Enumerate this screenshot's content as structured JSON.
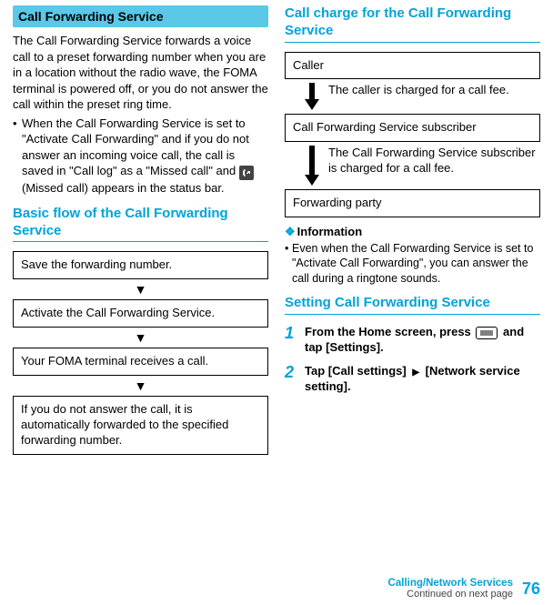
{
  "left": {
    "banner": "Call Forwarding Service",
    "intro": "The Call Forwarding Service forwards a voice call to a preset forwarding number when you are in a location without the radio wave, the FOMA terminal is powered off, or you do not answer the call within the preset ring time.",
    "bullet_pre": "When the Call Forwarding Service is set to \"Activate Call Forwarding\" and if you do not answer an incoming voice call, the call is saved in \"Call log\" as a \"Missed call\" and ",
    "bullet_post": " (Missed call) appears in the status bar.",
    "section_head": "Basic flow of the Call Forwarding Service",
    "flow": [
      "Save the forwarding number.",
      "Activate the Call Forwarding Service.",
      "Your FOMA terminal receives a call.",
      "If you do not answer the call, it is automatically forwarded to the specified forwarding number."
    ]
  },
  "right": {
    "section_head1": "Call charge for the Call Forwarding Service",
    "charge": {
      "box1": "Caller",
      "row1": "The caller is charged for a call fee.",
      "box2": "Call Forwarding Service subscriber",
      "row2": "The Call Forwarding Service subscriber is charged for a call fee.",
      "box3": "Forwarding party"
    },
    "info_label": "Information",
    "info_bullet": "Even when the Call Forwarding Service is set to \"Activate Call Forwarding\", you can answer the call during a ringtone sounds.",
    "section_head2": "Setting Call Forwarding Service",
    "steps": {
      "s1_pre": "From the Home screen, press ",
      "s1_post": " and tap [Settings].",
      "s2_pre": "Tap [Call settings] ",
      "s2_post": " [Network service setting]."
    }
  },
  "footer": {
    "service": "Calling/Network Services",
    "page": "76",
    "continued": "Continued on next page"
  }
}
